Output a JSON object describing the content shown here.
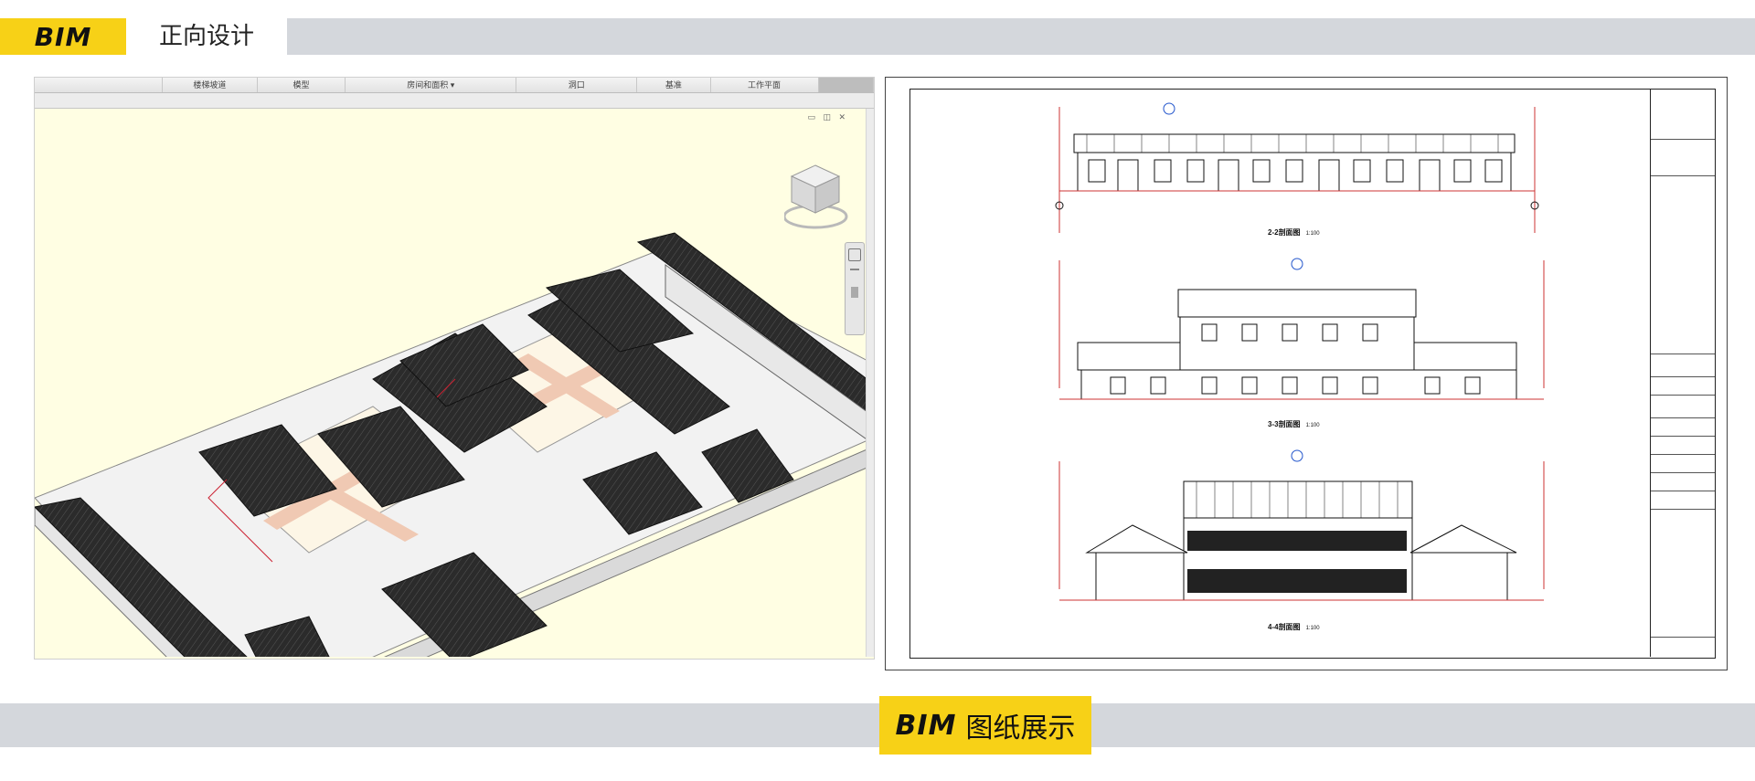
{
  "header": {
    "brand": "BIM",
    "title": "正向设计"
  },
  "footer": {
    "brand": "BIM",
    "label": "图纸展示"
  },
  "viewer": {
    "ribbon": [
      {
        "label": "楼梯坡道"
      },
      {
        "label": "模型"
      },
      {
        "label": "房间和面积 ▾"
      },
      {
        "label": "洞口"
      },
      {
        "label": "基准"
      },
      {
        "label": "工作平面"
      }
    ]
  },
  "drawing": {
    "sections": [
      {
        "title": "2-2剖面图",
        "scale": "1:100"
      },
      {
        "title": "3-3剖面图",
        "scale": "1:100"
      },
      {
        "title": "4-4剖面图",
        "scale": "1:100"
      }
    ]
  },
  "colors": {
    "accent": "#f7d117",
    "band": "#d4d7dc",
    "viewport": "#fffee3",
    "roof": "#2e2e2e",
    "wall": "#ededed",
    "courtyard": "#fdf6e6",
    "paving": "#f0c9b3"
  }
}
